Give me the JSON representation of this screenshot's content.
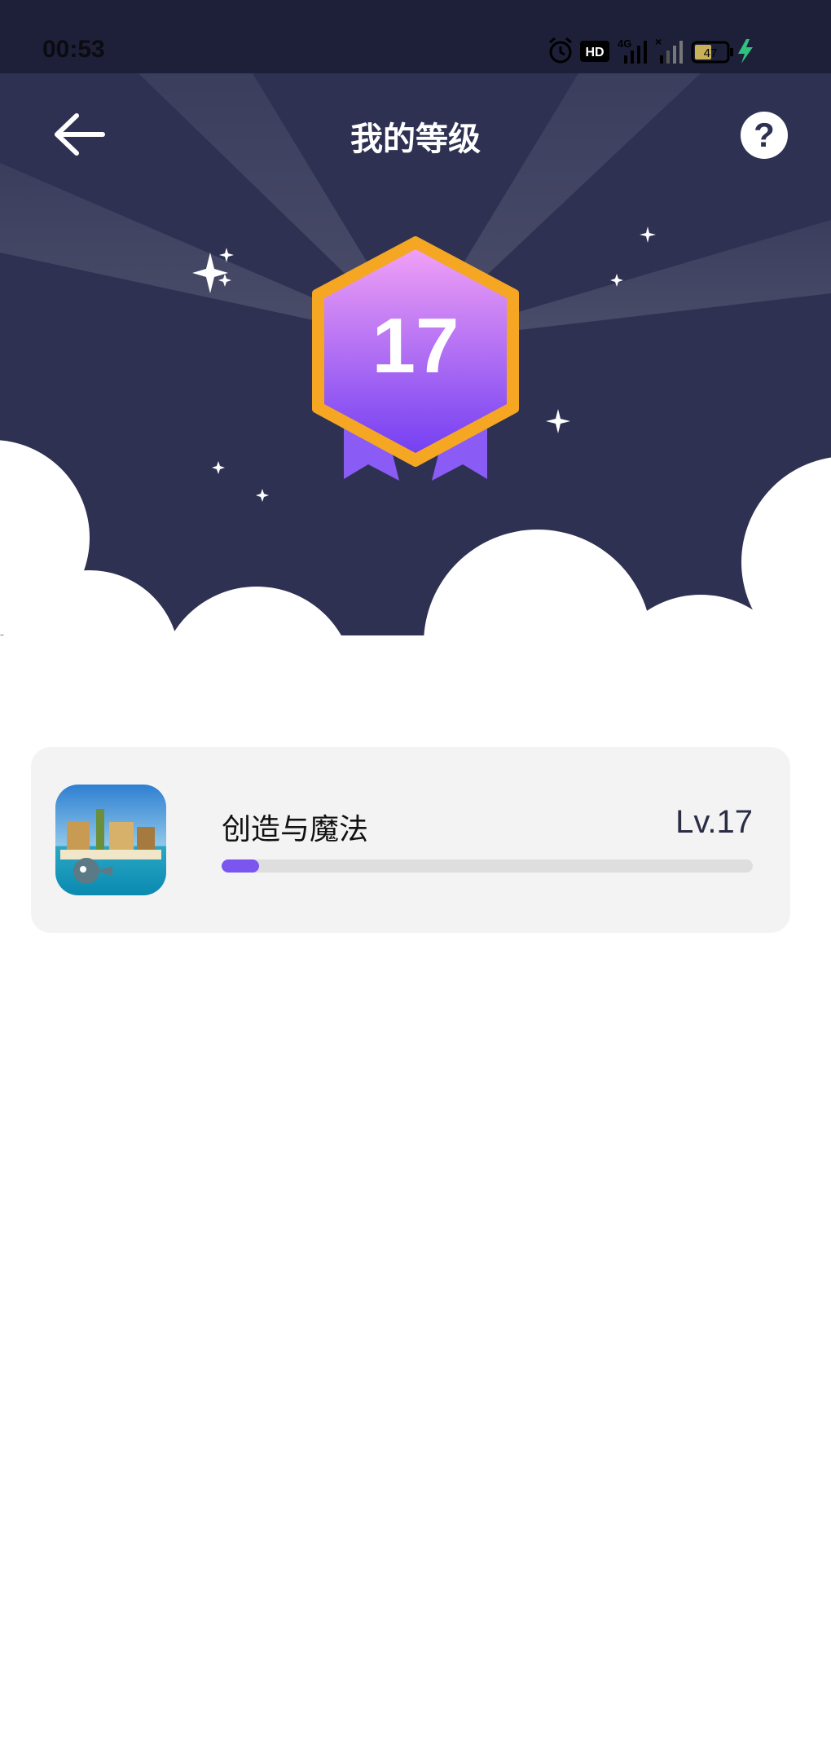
{
  "status_bar": {
    "time": "00:53",
    "battery": "47"
  },
  "header": {
    "title": "我的等级"
  },
  "badge": {
    "level": "17"
  },
  "game_card": {
    "name": "创造与魔法",
    "level_label": "Lv.17",
    "progress": 0.07
  },
  "colors": {
    "bg_dark": "#2e3152",
    "accent": "#7a55f0",
    "badge_gold": "#f5a623"
  }
}
